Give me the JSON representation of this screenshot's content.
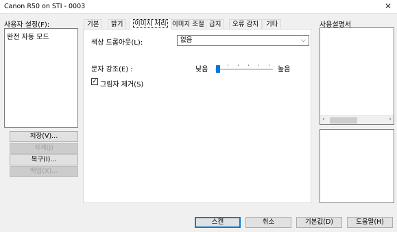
{
  "window": {
    "title": "Canon R50 on STI - 0003",
    "close_glyph": "✕"
  },
  "left": {
    "settings_label": "사용자 설정(F):",
    "list_items": [
      "완전 자동 모드"
    ],
    "buttons": {
      "save": "저장(V)...",
      "delete": "삭제(J)",
      "restore": "복구(I)...",
      "backup": "백업(X)..."
    }
  },
  "tabs": [
    "기본",
    "밝기",
    "이미지 처리",
    "이미지 조절",
    "급지",
    "오류 감지",
    "기타"
  ],
  "active_tab": "이미지 처리",
  "image_processing": {
    "color_dropout_label": "색상 드롭아웃(L):",
    "color_dropout_value": "없음",
    "edge_emphasis_label": "문자 강조(E) :",
    "slider_low": "낮음",
    "slider_high": "높음",
    "slider_level": 0,
    "shadow_removal_label": "그림자 제거(S)",
    "shadow_removal_checked": true
  },
  "right": {
    "manual_label": "사용설명서"
  },
  "footer": {
    "scan": "스캔",
    "cancel": "취소",
    "defaults": "기본값(D)",
    "help": "도움말(H)"
  },
  "colors": {
    "accent": "#0078d7"
  }
}
